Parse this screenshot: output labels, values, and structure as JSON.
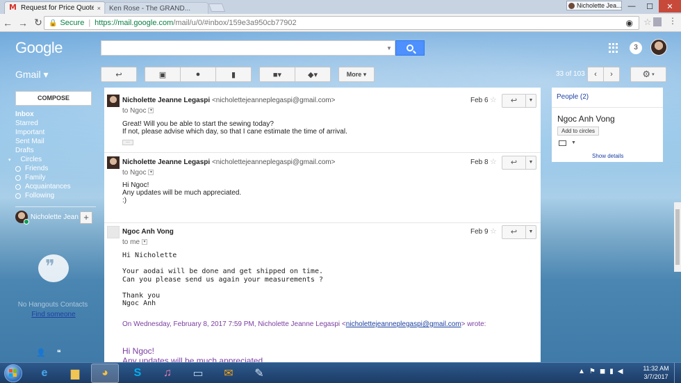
{
  "browser": {
    "active_tab_title": "Request for Price Quote",
    "inactive_tab_title": "Ken Rose - The GRAND...",
    "tab_close": "×",
    "user_label": "Nicholette Jea...",
    "win_min": "—",
    "win_max": "☐",
    "win_close": "✕",
    "back": "←",
    "forward": "→",
    "reload": "↻",
    "secure_label": "Secure",
    "url_host": "https://mail.google.com",
    "url_path": "/mail/u/0/#inbox/159e3a950cb77902",
    "menu": "⋮"
  },
  "gmail": {
    "logo": "Google",
    "notifications": "3",
    "app_label": "Gmail ▾",
    "more_label": "More ▾",
    "counter": "33 of 103",
    "compose_label": "COMPOSE",
    "nav": {
      "inbox": "Inbox",
      "starred": "Starred",
      "important": "Important",
      "sent": "Sent Mail",
      "drafts": "Drafts",
      "circles": "Circles",
      "friends": "Friends",
      "family": "Family",
      "acquaintances": "Acquaintances",
      "following": "Following"
    },
    "hangouts_user": "Nicholette Jean",
    "no_contacts": "No Hangouts Contacts",
    "find_someone": "Find someone"
  },
  "messages": [
    {
      "sender_name": "Nicholette Jeanne Legaspi",
      "sender_email": "<nicholettejeanneplegaspi@gmail.com>",
      "to": "to Ngoc",
      "date": "Feb 6",
      "body": "Great! Will you be able to start the sewing today?\nIf not, please advise which day, so that I cane estimate the time of arrival."
    },
    {
      "sender_name": "Nicholette Jeanne Legaspi",
      "sender_email": "<nicholettejeanneplegaspi@gmail.com>",
      "to": "to Ngoc",
      "date": "Feb 8",
      "body": "Hi Ngoc!\nAny updates will be much appreciated.\n:)"
    },
    {
      "sender_name": "Ngoc Anh Vong",
      "to": "to me",
      "date": "Feb 9",
      "body": "Hi Nicholette\n\nYour aodai will be done and get shipped on time.\nCan you please send us again your measurements ?\n\nThank you\nNgoc Anh",
      "quote_prefix": "On Wednesday, February 8, 2017 7:59 PM, Nicholette Jeanne Legaspi <",
      "quote_email": "nicholettejeanneplegaspi@gmail.com",
      "quote_suffix": "> wrote:",
      "quote_body": "Hi Ngoc!\nAny updates will be much appreciated."
    }
  ],
  "people": {
    "title": "People (2)",
    "name": "Ngoc Anh Vong",
    "add_to_circles": "Add to circles",
    "show_details": "Show details"
  },
  "taskbar": {
    "time": "11:32 AM",
    "date": "3/7/2017"
  },
  "colors": {
    "accent_blue": "#4d90fe",
    "link_blue": "#1a3fa0",
    "quote_purple": "#7a3da0"
  }
}
